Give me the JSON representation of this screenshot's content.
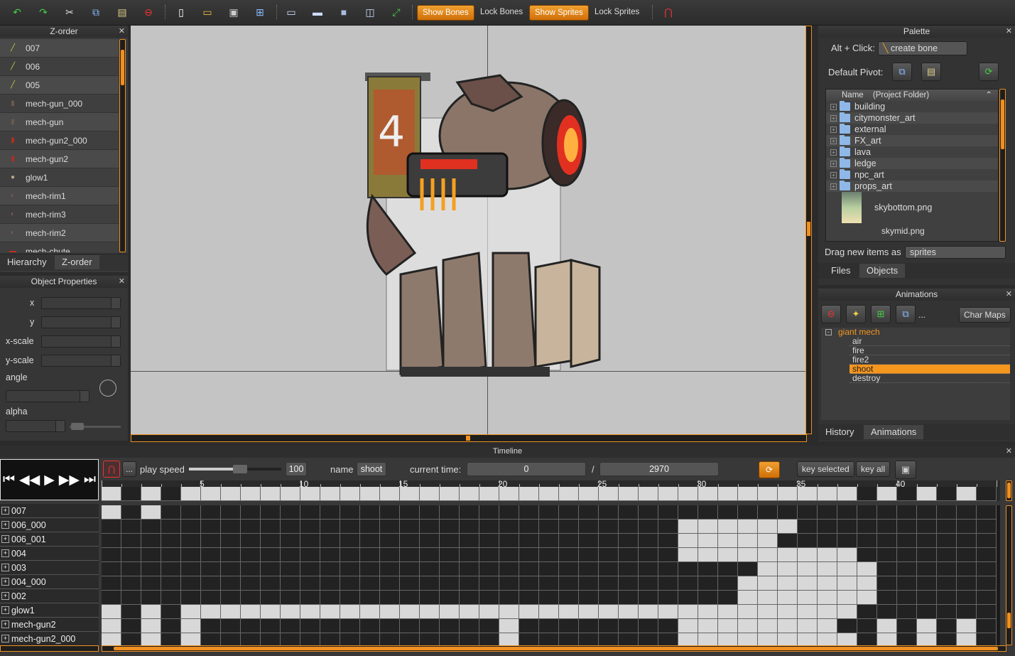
{
  "toolbar": {
    "show_bones": "Show Bones",
    "lock_bones": "Lock Bones",
    "show_sprites": "Show Sprites",
    "lock_sprites": "Lock Sprites"
  },
  "zorder": {
    "title": "Z-order",
    "items": [
      "007",
      "006",
      "005",
      "mech-gun_000",
      "mech-gun",
      "mech-gun2_000",
      "mech-gun2",
      "glow1",
      "mech-rim1",
      "mech-rim3",
      "mech-rim2",
      "mech-chute"
    ],
    "tabs": {
      "hierarchy": "Hierarchy",
      "zorder": "Z-order"
    }
  },
  "props": {
    "title": "Object Properties",
    "x": "x",
    "y": "y",
    "xscale": "x-scale",
    "yscale": "y-scale",
    "angle": "angle",
    "alpha": "alpha"
  },
  "palette": {
    "title": "Palette",
    "alt_click": "Alt + Click:",
    "create_bone": "create bone",
    "default_pivot": "Default Pivot:",
    "col_name": "Name",
    "col_folder": "(Project Folder)",
    "folders": [
      "building",
      "citymonster_art",
      "external",
      "FX_art",
      "lava",
      "ledge",
      "npc_art",
      "props_art"
    ],
    "file1": "skybottom.png",
    "file2": "skymid.png",
    "drag_new": "Drag new items as",
    "drag_value": "sprites",
    "tabs": {
      "files": "Files",
      "objects": "Objects"
    }
  },
  "animations": {
    "title": "Animations",
    "char_maps": "Char Maps",
    "more": "...",
    "root": "giant mech",
    "items": [
      "air",
      "fire",
      "fire2",
      "shoot",
      "destroy"
    ],
    "selected": "shoot",
    "tabs": {
      "history": "History",
      "animations": "Animations"
    }
  },
  "timeline": {
    "title": "Timeline",
    "more": "...",
    "play_speed_label": "play speed",
    "play_speed": "100",
    "name_label": "name",
    "name": "shoot",
    "current_time_label": "current time:",
    "current_time": "0",
    "slash": "/",
    "total_time": "2970",
    "key_selected": "key selected",
    "key_all": "key all",
    "ticks": [
      "5",
      "10",
      "15",
      "20",
      "25",
      "30",
      "35",
      "40"
    ],
    "tracks": [
      "007",
      "006_000",
      "006_001",
      "004",
      "003",
      "004_000",
      "002",
      "glow1",
      "mech-gun2",
      "mech-gun2_000"
    ]
  },
  "colors": {
    "accent": "#f09020",
    "key_cell": "#d8d8d8",
    "empty_cell": "#222222",
    "selected_anim": "#f5961e"
  }
}
